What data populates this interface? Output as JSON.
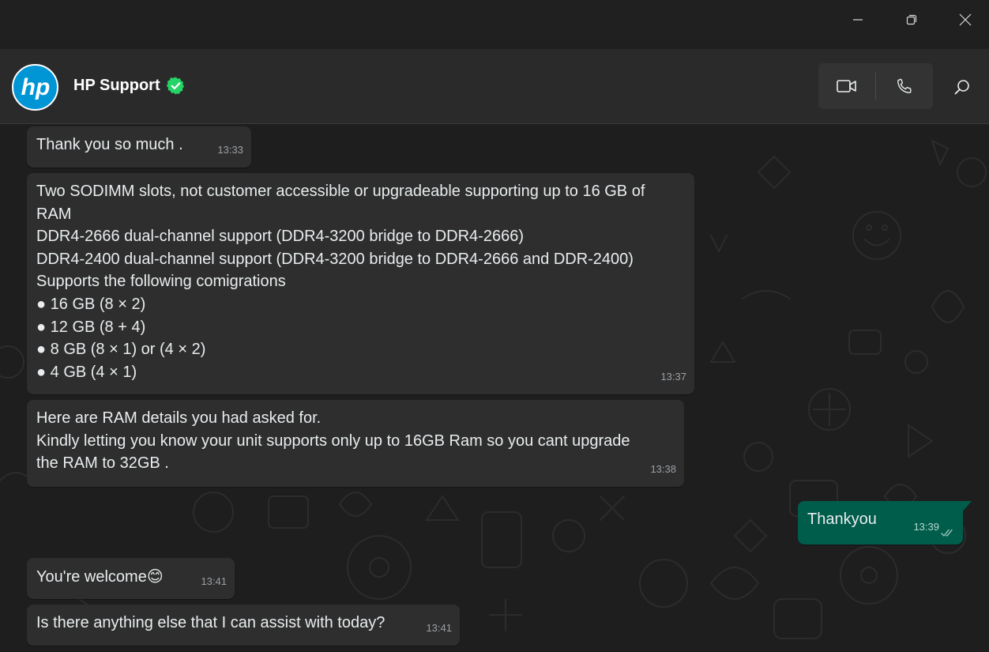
{
  "window": {
    "controls": [
      "minimize",
      "restore",
      "close"
    ]
  },
  "header": {
    "contact_name": "HP Support",
    "verified": true,
    "avatar_text": "hp",
    "brand_color": "#0096d6",
    "verified_color": "#25d366"
  },
  "messages": [
    {
      "direction": "in",
      "text": "Thank you so much .",
      "time": "13:33"
    },
    {
      "direction": "in",
      "text": "Two SODIMM slots, not customer accessible or upgradeable supporting up to 16 GB of\nRAM\nDDR4-2666 dual-channel support (DDR4-3200 bridge to DDR4-2666)\nDDR4-2400 dual-channel support (DDR4-3200 bridge to DDR4-2666 and DDR-2400)\nSupports the following comigrations\n● 16 GB (8 × 2)\n● 12 GB (8 + 4)\n● 8 GB (8 × 1) or (4 × 2)\n● 4 GB (4 × 1)",
      "time": "13:37"
    },
    {
      "direction": "in",
      "text": "Here are RAM details  you had asked for.\nKindly letting you know your unit supports only up to 16GB Ram so you cant upgrade\nthe RAM to 32GB .",
      "time": "13:38"
    },
    {
      "direction": "out",
      "text": "Thankyou",
      "time": "13:39",
      "status": "read"
    },
    {
      "direction": "in",
      "text": "You're welcome",
      "emoji": "😊",
      "time": "13:41"
    },
    {
      "direction": "in",
      "text": "Is there anything else that I can assist with today?",
      "time": "13:41"
    }
  ],
  "colors": {
    "incoming_bubble": "#2e2e2e",
    "outgoing_bubble": "#005c4b"
  }
}
